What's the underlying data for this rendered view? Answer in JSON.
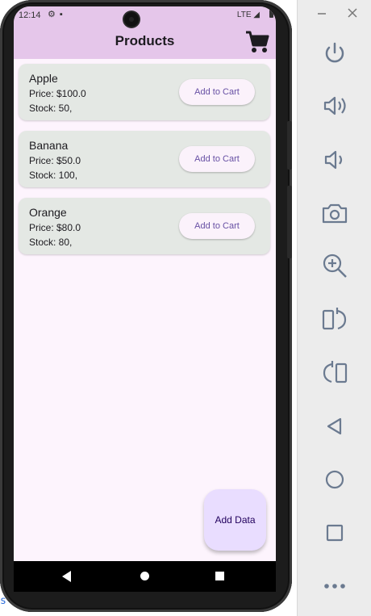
{
  "status_bar": {
    "time": "12:14",
    "network": "LTE"
  },
  "app_bar": {
    "title": "Products",
    "cart_icon": "shopping-cart-icon"
  },
  "products": [
    {
      "name": "Apple",
      "price": "Price: $100.0",
      "stock": "Stock: 50,",
      "button_label": "Add to Cart"
    },
    {
      "name": "Banana",
      "price": "Price: $50.0",
      "stock": "Stock: 100,",
      "button_label": "Add to Cart"
    },
    {
      "name": "Orange",
      "price": "Price: $80.0",
      "stock": "Stock: 80,",
      "button_label": "Add to Cart"
    }
  ],
  "fab": {
    "label": "Add Data"
  },
  "nav_bar": {
    "icons": [
      "back-icon",
      "home-icon",
      "recents-icon"
    ]
  },
  "background_text": "s",
  "emulator_panel": {
    "window_controls": [
      "minimize-icon",
      "close-icon"
    ],
    "buttons": [
      "power-icon",
      "volume-up-icon",
      "volume-down-icon",
      "camera-icon",
      "zoom-icon",
      "rotate-left-icon",
      "rotate-right-icon",
      "back-icon",
      "home-icon",
      "overview-icon",
      "more-icon"
    ]
  },
  "colors": {
    "app_bar": "#e5c6ea",
    "screen_background": "#fdf4fd",
    "card": "#e4e8e4",
    "button_text": "#6750a4",
    "fab": "#e9ddff"
  }
}
